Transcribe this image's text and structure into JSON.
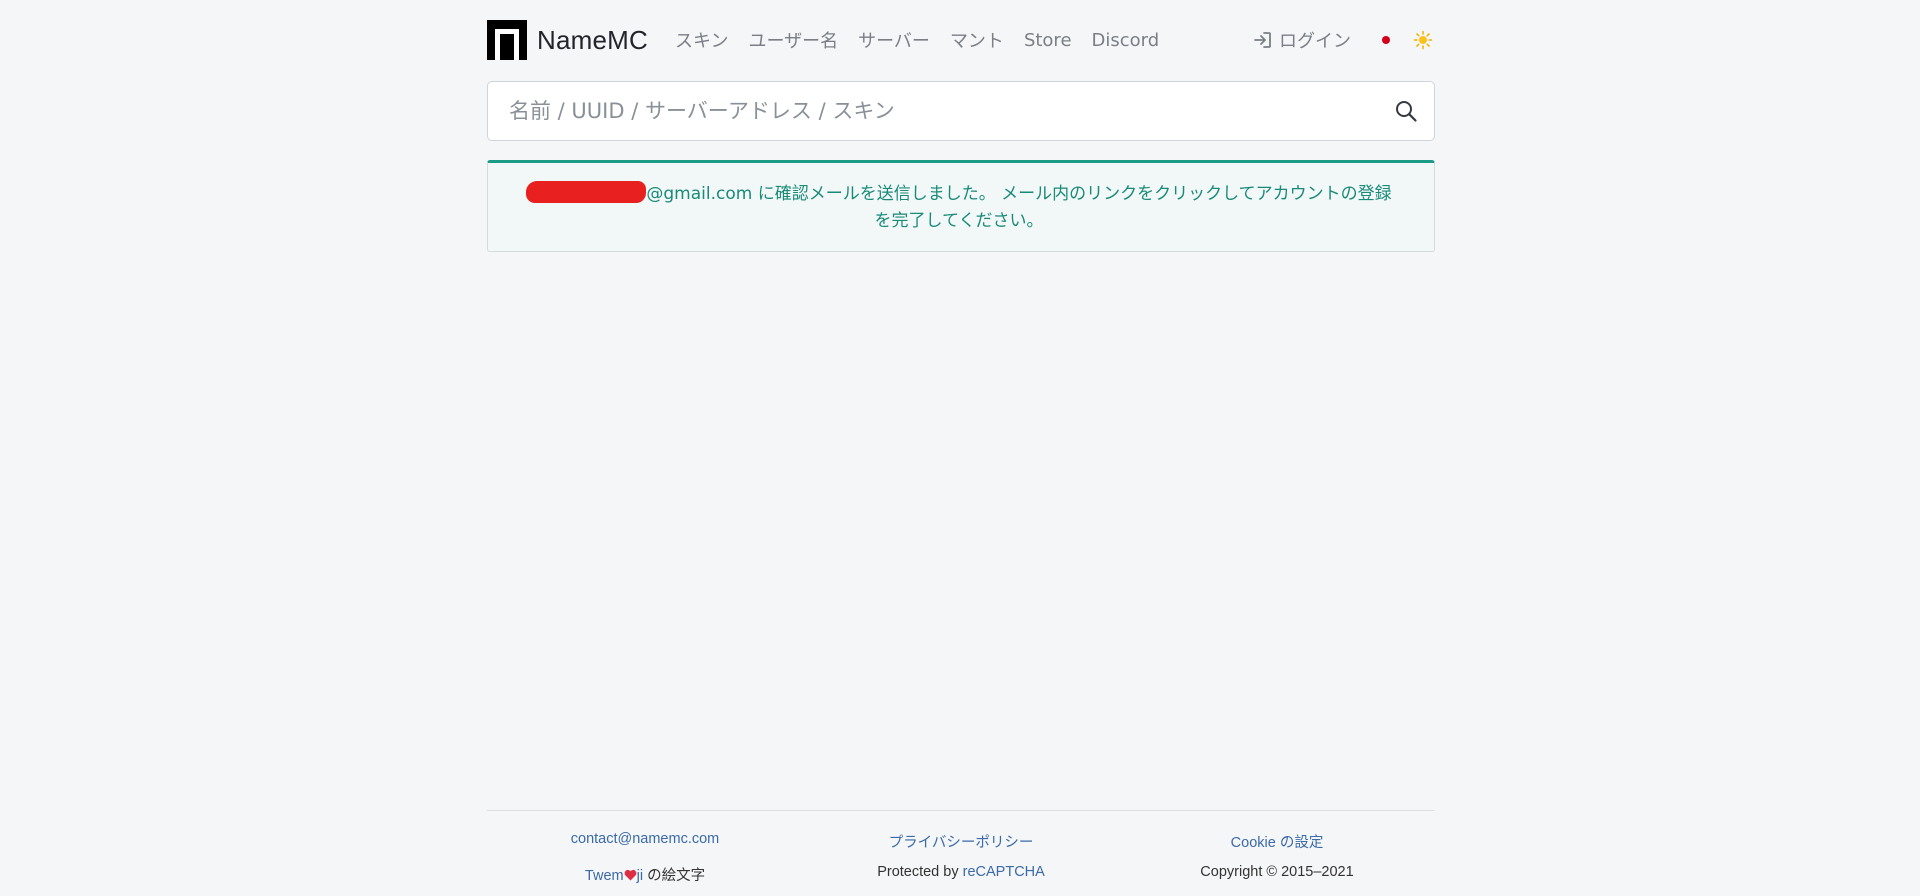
{
  "brand": {
    "name": "NameMC"
  },
  "nav": {
    "items": [
      {
        "label": "スキン"
      },
      {
        "label": "ユーザー名"
      },
      {
        "label": "サーバー"
      },
      {
        "label": "マント"
      },
      {
        "label": "Store"
      },
      {
        "label": "Discord"
      }
    ],
    "login_label": "ログイン"
  },
  "search": {
    "placeholder": "名前 / UUID / サーバーアドレス / スキン",
    "value": ""
  },
  "alert": {
    "email_suffix": "@gmail.com",
    "message_line1": " に確認メールを送信しました。 メール内のリンクをクリックしてアカウントの登録",
    "message_line2": "を完了してください。",
    "accent_color": "#1a9c87"
  },
  "footer": {
    "contact": "contact@namemc.com",
    "privacy": "プライバシーポリシー",
    "cookie": "Cookie の設定",
    "twemoji_pre": "Twem",
    "twemoji_post": "ji",
    "emoji_label": " の絵文字",
    "protected_by": "Protected by ",
    "recaptcha": "reCAPTCHA",
    "copyright": "Copyright © 2015–2021"
  }
}
